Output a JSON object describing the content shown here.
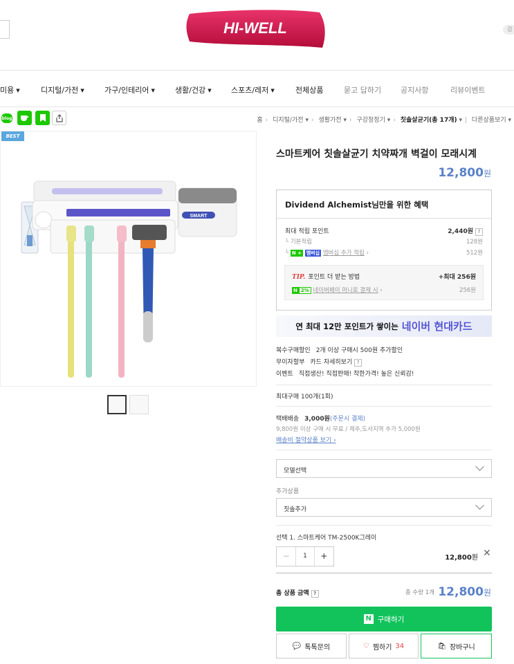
{
  "header": {
    "logo_text": "HI-WELL",
    "right_stub": "검"
  },
  "nav": {
    "items": [
      {
        "label": "미용",
        "caret": true
      },
      {
        "label": "디지털/가전",
        "caret": true
      },
      {
        "label": "가구/인테리어",
        "caret": true
      },
      {
        "label": "생활/건강",
        "caret": true
      },
      {
        "label": "스포츠/레저",
        "caret": true
      },
      {
        "label": "전체상품",
        "caret": false
      },
      {
        "label": "묻고 답하기",
        "caret": false
      },
      {
        "label": "공지사항",
        "caret": false
      },
      {
        "label": "리뷰이벤트",
        "caret": false
      }
    ]
  },
  "share": {
    "icons": [
      "blog-share-icon",
      "cafe-share-icon",
      "bookmark-icon",
      "share-link-icon"
    ]
  },
  "breadcrumb": {
    "home": "홈",
    "c1": "디지털/가전",
    "c2": "생활가전",
    "c3": "구강청정기",
    "c4": "칫솔살균기(총 17개)",
    "other": "다른상품보기"
  },
  "product": {
    "badge": "BEST",
    "title": "스마트케어 칫솔살균기 치약짜개 벽걸이 모래시계",
    "price": "12,800",
    "won": "원"
  },
  "benefit": {
    "title": "Dividend Alchemist님만을 위한 혜택",
    "max_points_label": "최대 적립 포인트",
    "max_points_value": "2,440원",
    "basic_label": "기본적립",
    "basic_value": "128원",
    "membership_label": "멤버십 추가 적립",
    "membership_tag": "멤버십",
    "membership_value": "512원",
    "tip_tag": "TIP.",
    "tip_label": "포인트 더 받는 방법",
    "tip_value": "+최대 256원",
    "tip_pct": "2%",
    "tip_sub_label": "네이버페이 머니로 결제 시",
    "tip_sub_value": "256원"
  },
  "banner": {
    "text1": "연 최대 12만 포인트가 쌓이는",
    "text2": "네이버 현대카드"
  },
  "info": {
    "multi_key": "복수구매할인",
    "multi_val": "2개 이상 구매시 500원 추가할인",
    "install_key": "무이자할부",
    "install_val": "카드 자세히보기",
    "event_key": "이벤트",
    "event_val": "직접생산! 직접판매! 착한가격! 높은 신뢰감!",
    "max_buy": "최대구매 100개(1회)",
    "ship_key": "택배배송",
    "ship_price": "3,000원",
    "ship_cond": "(주문시 결제)",
    "ship_note": "9,800원 이상 구매 시 무료 / 제주,도서지역 추가 5,000원",
    "ship_link": "배송비 절약상품 보기"
  },
  "options": {
    "model_placeholder": "모델선택",
    "add_label": "추가상품",
    "add_placeholder": "칫솔추가"
  },
  "selection": {
    "label": "선택 1. 스마트케어 TM-2500K그레이",
    "qty": "1",
    "price": "12,800",
    "won": "원"
  },
  "total": {
    "label": "총 상품 금액",
    "count": "총 수량 1개",
    "price": "12,800",
    "won": "원"
  },
  "buttons": {
    "buy": "구매하기",
    "talk": "톡톡문의",
    "wish": "찜하기",
    "wish_count": "34",
    "cart": "장바구니"
  },
  "colors": {
    "accent_price": "#5b82c8",
    "buy_green": "#12c35c",
    "logo_red": "#d6174a"
  }
}
